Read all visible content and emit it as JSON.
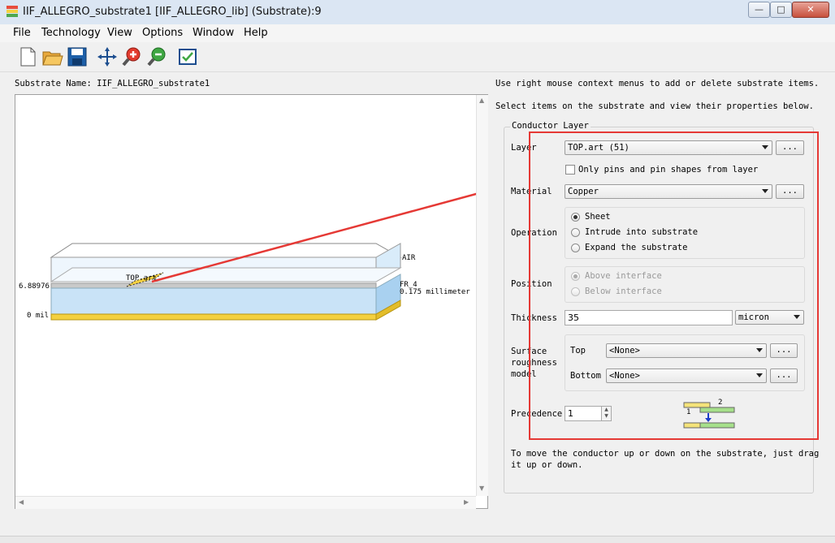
{
  "window": {
    "title": "IIF_ALLEGRO_substrate1 [IIF_ALLEGRO_lib] (Substrate):9",
    "min": "—",
    "max": "□",
    "close": "✕"
  },
  "menu": [
    "File",
    "Technology",
    "View",
    "Options",
    "Window",
    "Help"
  ],
  "toolbar": [
    "new-file-icon",
    "open-folder-icon",
    "save-icon",
    "pan-icon",
    "zoom-in-icon",
    "zoom-out-icon",
    "check-icon"
  ],
  "substrate_name": "Substrate Name:  IIF_ALLEGRO_substrate1",
  "hint_top": "Use right mouse context menus to add or delete substrate items.",
  "hint_select": "Select items on the substrate and view their properties below.",
  "diagram": {
    "air_label": "AIR",
    "fr4_label": "FR_4",
    "fr4_thickness": "0.175 millimeter",
    "level_top": "6.88976",
    "level_bottom": "0 mil",
    "conductor_label": "TOP.art"
  },
  "conductor": {
    "group_title": "Conductor Layer",
    "layer_label": "Layer",
    "layer_value": "TOP.art (51)",
    "only_pins_label": "Only pins and pin shapes from layer",
    "material_label": "Material",
    "material_value": "Copper",
    "operation_label": "Operation",
    "operations": [
      "Sheet",
      "Intrude into substrate",
      "Expand the substrate"
    ],
    "position_label": "Position",
    "positions": [
      "Above interface",
      "Below interface"
    ],
    "thickness_label": "Thickness",
    "thickness_value": "35",
    "thickness_unit": "micron",
    "roughness_label_1": "Surface",
    "roughness_label_2": "roughness",
    "roughness_label_3": "model",
    "top_label": "Top",
    "top_value": "<None>",
    "bottom_label": "Bottom",
    "bottom_value": "<None>",
    "precedence_label": "Precedence",
    "precedence_value": "1",
    "dots": "...",
    "precedence_icon_labels": [
      "2",
      "1"
    ]
  },
  "footer_hint_1": "To move the conductor up or down on the substrate, just drag",
  "footer_hint_2": "it up or down.",
  "colors": {
    "annotation_red": "#e53935",
    "conductor_yellow": "#f4d03f",
    "dielectric_blue": "#c9e3f7"
  }
}
